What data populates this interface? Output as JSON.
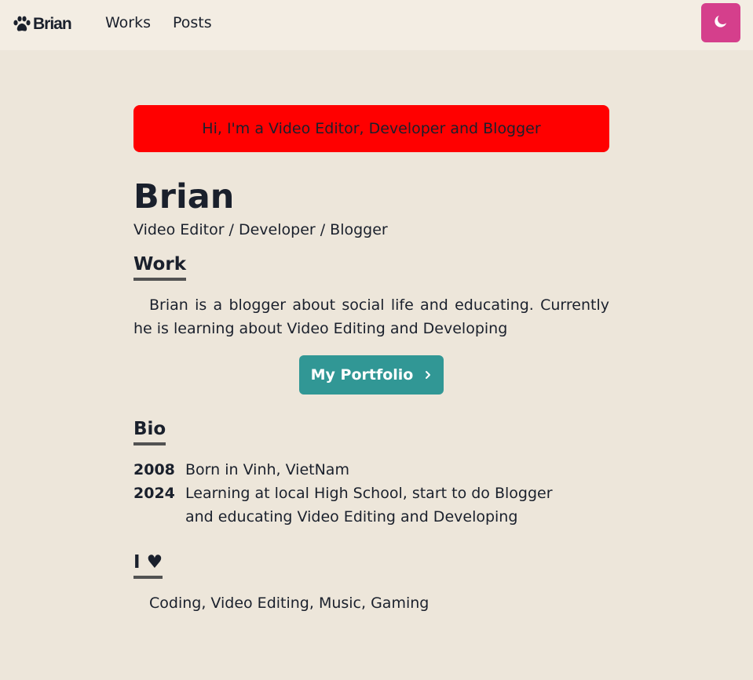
{
  "nav": {
    "logo_text": "Brian",
    "links": [
      "Works",
      "Posts"
    ],
    "theme_icon": "moon-icon"
  },
  "hero": {
    "greeting": "Hi, I'm a Video Editor, Developer and Blogger",
    "name": "Brian",
    "subtitle": "Video Editor / Developer / Blogger"
  },
  "work": {
    "heading": "Work",
    "paragraph": "Brian is a blogger about social life and educating. Currently he is learning about Video Editing and Developing",
    "button_label": "My Portfolio",
    "button_icon": "chevron-right-icon"
  },
  "bio": {
    "heading": "Bio",
    "entries": [
      {
        "year": "2008",
        "text": "Born in Vinh, VietNam"
      },
      {
        "year": "2024",
        "text": "Learning at local High School, start to do Blogger and educating Video Editing and Developing"
      }
    ]
  },
  "love": {
    "heading": "I ♥",
    "text": "Coding, Video Editing, Music, Gaming"
  },
  "colors": {
    "background": "#ede6da",
    "navbar": "#f3ede3",
    "theme_button": "#d53f8c",
    "greeting_bg": "#ff0000",
    "portfolio_button": "#319795"
  }
}
